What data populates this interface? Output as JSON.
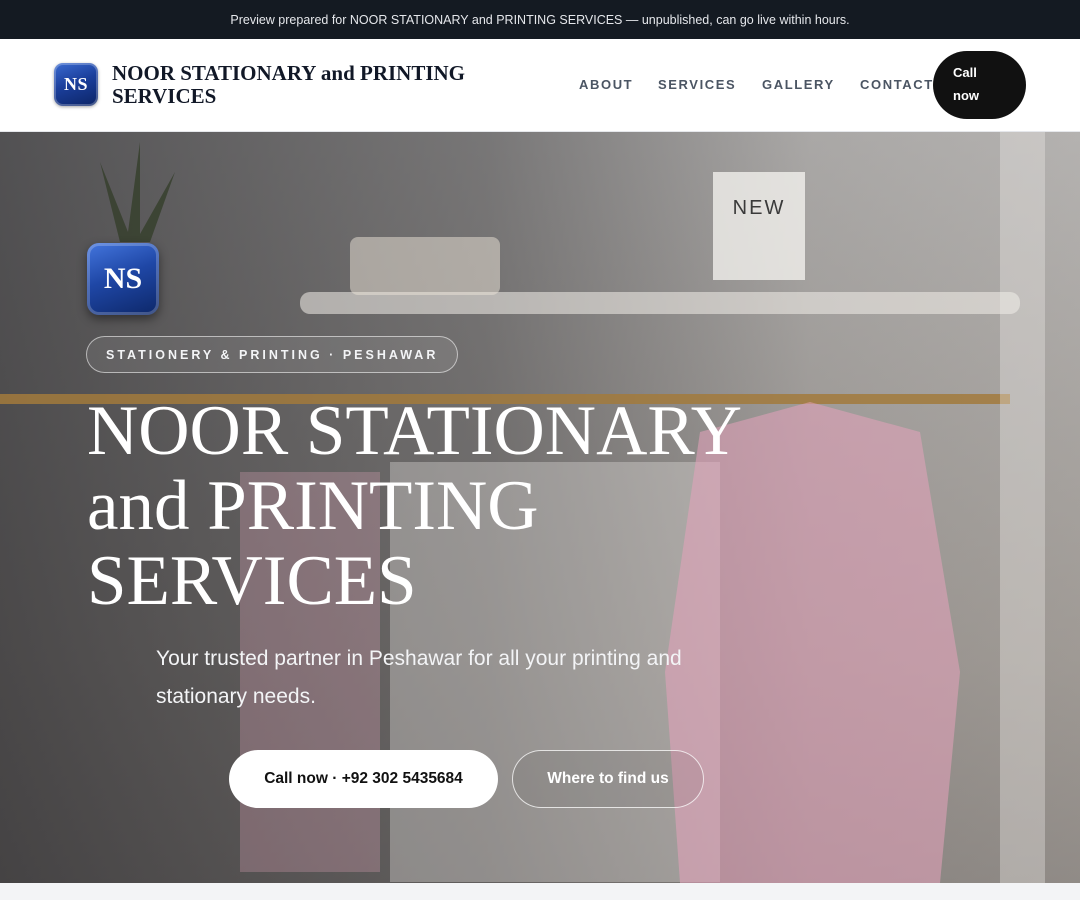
{
  "preview_banner": {
    "text": "Preview prepared for NOOR STATIONARY and PRINTING SERVICES — unpublished, can go live within hours."
  },
  "header": {
    "logo_text": "NS",
    "brand_name": "NOOR STATIONARY and PRINTING SERVICES",
    "nav": [
      {
        "label": "ABOUT"
      },
      {
        "label": "SERVICES"
      },
      {
        "label": "GALLERY"
      },
      {
        "label": "CONTACT"
      }
    ],
    "call_button": "Call now"
  },
  "hero": {
    "logo_text": "NS",
    "eyebrow": "STATIONERY & PRINTING · PESHAWAR",
    "title": "NOOR STATIONARY and PRINTING SERVICES",
    "subtitle": "Your trusted partner in Peshawar for all your printing and stationary needs.",
    "primary_cta": "Call now · +92 302 5435684",
    "secondary_cta": "Where to find us",
    "background_sign": "NEW"
  },
  "colors": {
    "top_bar": "#141a22",
    "logo_blue": "#1b3f9c",
    "primary_button_bg": "#ffffff",
    "dark_button_bg": "#111111"
  }
}
